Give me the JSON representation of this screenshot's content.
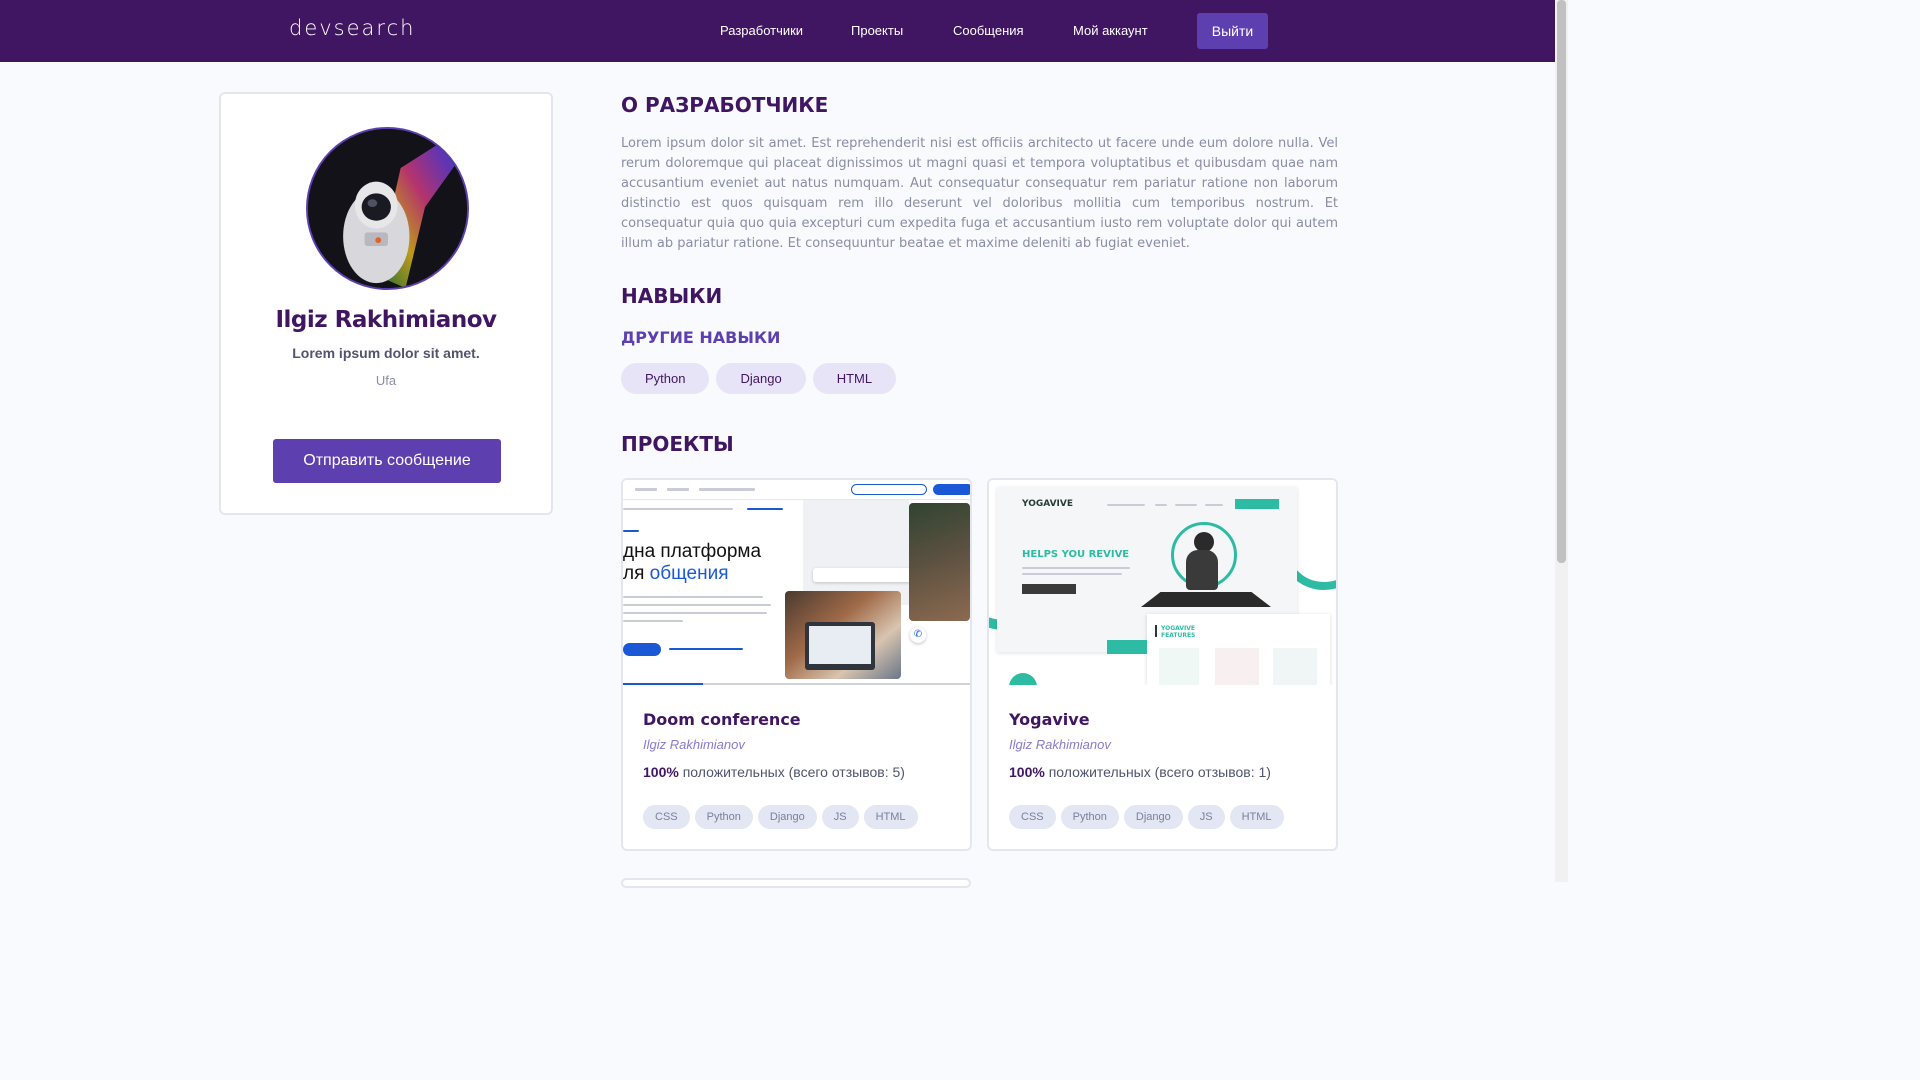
{
  "header": {
    "logo": "devsearch",
    "nav": [
      "Разработчики",
      "Проекты",
      "Сообщения",
      "Мой аккаунт"
    ],
    "logout_label": "Выйти"
  },
  "profile": {
    "name": "Ilgiz Rakhimianov",
    "headline": "Lorem ipsum dolor sit amet.",
    "location": "Ufa",
    "send_message_label": "Отправить сообщение"
  },
  "about": {
    "title": "О РАЗРАБОТЧИКЕ",
    "text": "Lorem ipsum dolor sit amet. Est reprehenderit nisi est officiis architecto ut facere unde eum dolore nulla. Vel rerum doloremque qui placeat dignissimos ut magni quasi et tempora voluptatibus et quibusdam quae nam accusantium eveniet aut natus numquam. Aut consequatur consequatur rem pariatur ratione non laborum distinctio est quos quisquam rem illo deserunt vel doloribus mollitia cum temporibus nostrum. Et consequatur quia quo quia excepturi cum expedita fuga et accusantium iusto rem voluptate dolor qui autem illum ab pariatur ratione. Et consequuntur beatae et maxime deleniti ab fugiat eveniet."
  },
  "skills": {
    "title": "НАВЫКИ",
    "other_title": "ДРУГИЕ НАВЫКИ",
    "other": [
      "Python",
      "Django",
      "HTML"
    ]
  },
  "projects": {
    "title": "ПРОЕКТЫ",
    "items": [
      {
        "title": "Doom conference",
        "author": "Ilgiz Rakhimianov",
        "vote_percent": "100%",
        "vote_text": "положительных (всего отзывов: 5)",
        "tags": [
          "CSS",
          "Python",
          "Django",
          "JS",
          "HTML"
        ],
        "thumb": {
          "line1": "дна платформа",
          "line2a": "ля ",
          "line2b": "общения"
        }
      },
      {
        "title": "Yogavive",
        "author": "Ilgiz Rakhimianov",
        "vote_percent": "100%",
        "vote_text": "положительных (всего отзывов: 1)",
        "tags": [
          "CSS",
          "Python",
          "Django",
          "JS",
          "HTML"
        ],
        "thumb": {
          "brand": "YOGAVIVE",
          "headline": "HELPS YOU REVIVE",
          "features": "YOGAVIVE FEATURES"
        }
      }
    ]
  },
  "colors": {
    "header_bg": "#401562",
    "accent": "#5e3fb0",
    "title": "#401562",
    "page_bg": "#f8fafd"
  }
}
